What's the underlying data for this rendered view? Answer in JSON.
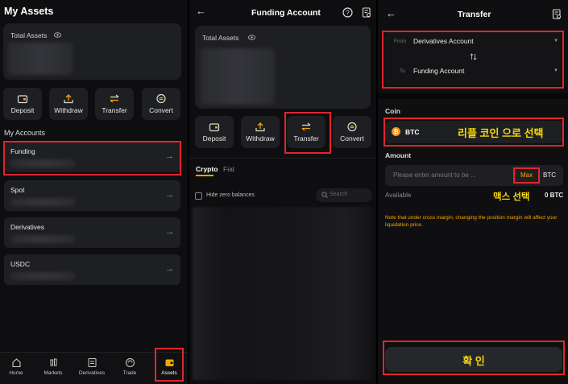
{
  "assets": {
    "title": "My Assets",
    "total_assets_label": "Total Assets",
    "actions": [
      {
        "label": "Deposit",
        "icon": "deposit-icon"
      },
      {
        "label": "Withdraw",
        "icon": "withdraw-icon"
      },
      {
        "label": "Transfer",
        "icon": "transfer-icon"
      },
      {
        "label": "Convert",
        "icon": "convert-icon"
      }
    ],
    "my_accounts_label": "My Accounts",
    "accounts": [
      {
        "label": "Funding"
      },
      {
        "label": "Spot"
      },
      {
        "label": "Derivatives"
      },
      {
        "label": "USDC"
      }
    ],
    "nav": [
      {
        "label": "Home",
        "icon": "home-icon"
      },
      {
        "label": "Markets",
        "icon": "markets-icon"
      },
      {
        "label": "Derivatives",
        "icon": "derivatives-icon"
      },
      {
        "label": "Trade",
        "icon": "trade-icon"
      },
      {
        "label": "Assets",
        "icon": "wallet-icon"
      }
    ]
  },
  "funding": {
    "title": "Funding Account",
    "total_assets_label": "Total Assets",
    "actions": [
      {
        "label": "Deposit",
        "icon": "deposit-icon"
      },
      {
        "label": "Withdraw",
        "icon": "withdraw-icon"
      },
      {
        "label": "Transfer",
        "icon": "transfer-icon"
      },
      {
        "label": "Convert",
        "icon": "convert-icon"
      }
    ],
    "tabs": [
      "Crypto",
      "Fiat"
    ],
    "hide_zero_label": "Hide zero balances",
    "search_placeholder": "Search"
  },
  "transfer": {
    "title": "Transfer",
    "from_label": "From",
    "from_value": "Derivatives Account",
    "to_label": "To",
    "to_value": "Funding Account",
    "coin_label": "Coin",
    "coin_value": "BTC",
    "coin_annotation": "리플 코인 으로 선택",
    "amount_label": "Amount",
    "amount_placeholder": "Please enter amount to be ...",
    "max_label": "Max",
    "amount_unit": "BTC",
    "available_label": "Available",
    "max_annotation": "맥스 선택",
    "available_value": "0 BTC",
    "note": "Note that under cross margin, changing the position margin will affect your liquidation price.",
    "confirm_label": "확 인"
  },
  "colors": {
    "accent": "#f7a600",
    "highlight": "#e0262d",
    "annotation": "#f5d90a",
    "card": "#1e1f22"
  }
}
